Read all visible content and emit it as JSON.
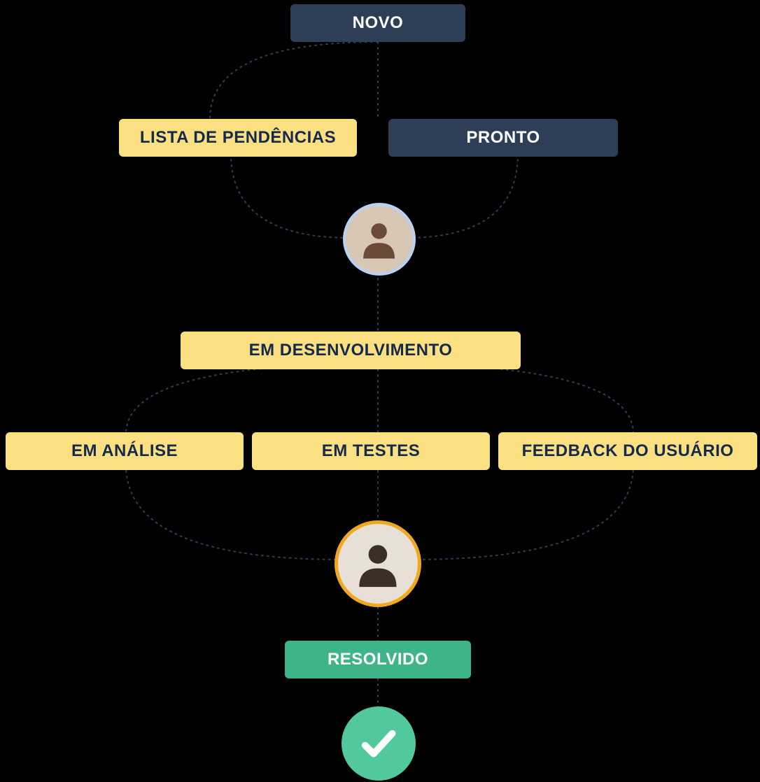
{
  "workflow": {
    "stages": {
      "novo": "NOVO",
      "pronto": "PRONTO",
      "lista_pendencias": "LISTA DE PENDÊNCIAS",
      "em_desenvolvimento": "EM DESENVOLVIMENTO",
      "em_analise": "EM ANÁLISE",
      "em_testes": "EM TESTES",
      "feedback_usuario": "FEEDBACK DO USUÁRIO",
      "resolvido": "RESOLVIDO"
    },
    "colors": {
      "navy": "#2e3e57",
      "yellow": "#fbe081",
      "green": "#3eb489",
      "success": "#52c99c",
      "avatar_border_blue": "#b9d2f4",
      "avatar_border_orange": "#f0a81f"
    }
  }
}
